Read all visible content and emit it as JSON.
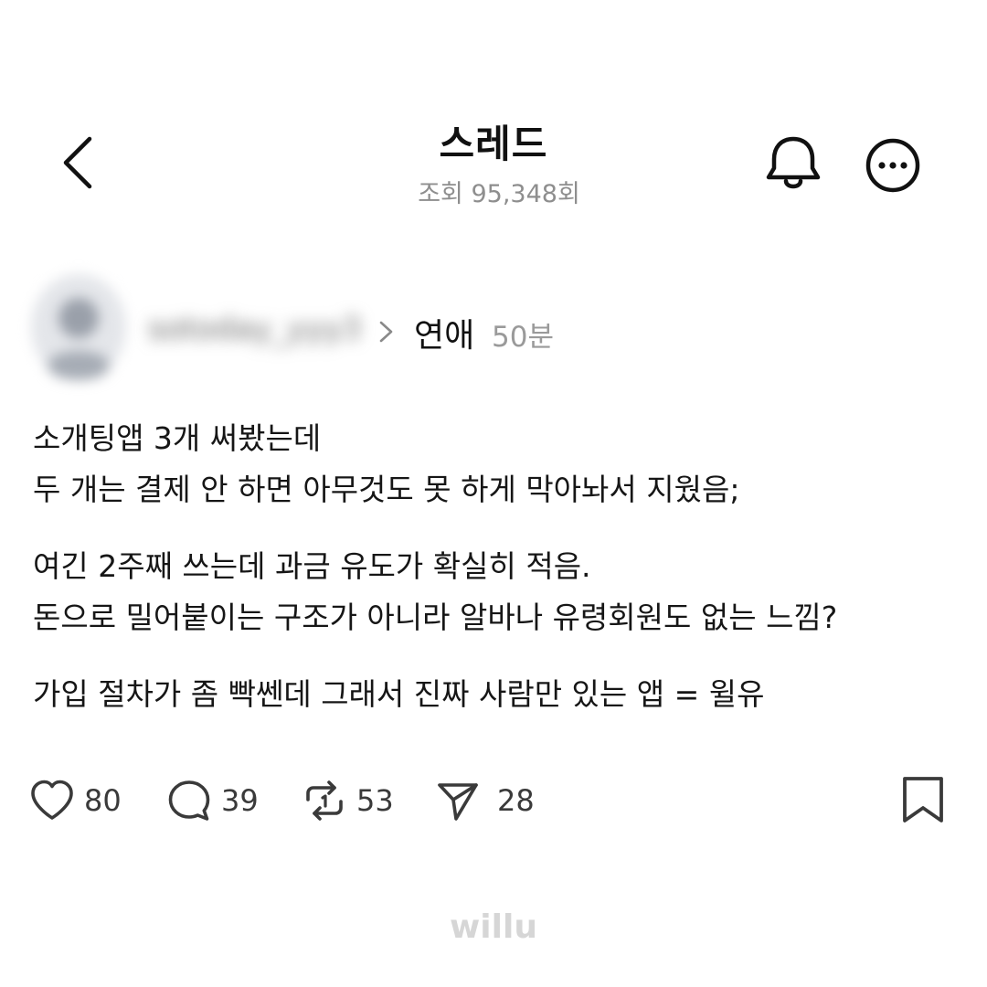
{
  "header": {
    "title": "스레드",
    "views": "조회 95,348회"
  },
  "author": {
    "username": "sotoday_yyy3",
    "category": "연애",
    "time_ago": "50분"
  },
  "post": {
    "paragraphs": [
      [
        "소개팅앱 3개 써봤는데",
        "두 개는 결제 안 하면 아무것도 못 하게 막아놔서 지웠음;"
      ],
      [
        "여긴 2주째 쓰는데 과금 유도가 확실히 적음.",
        "돈으로 밀어붙이는 구조가 아니라 알바나 유령회원도 없는 느낌?"
      ],
      [
        "가입 절차가 좀 빡쎈데 그래서 진짜 사람만 있는 앱 = 윌유"
      ]
    ]
  },
  "actions": {
    "likes": "80",
    "comments": "39",
    "reposts": "53",
    "shares": "28"
  },
  "icons": {
    "back": "chevron-left-icon",
    "bell": "bell-icon",
    "more": "more-horizontal-icon",
    "heart": "heart-icon",
    "comment": "comment-bubble-icon",
    "repost": "repost-icon",
    "share": "send-icon",
    "bookmark": "bookmark-icon"
  },
  "watermark": "willu"
}
